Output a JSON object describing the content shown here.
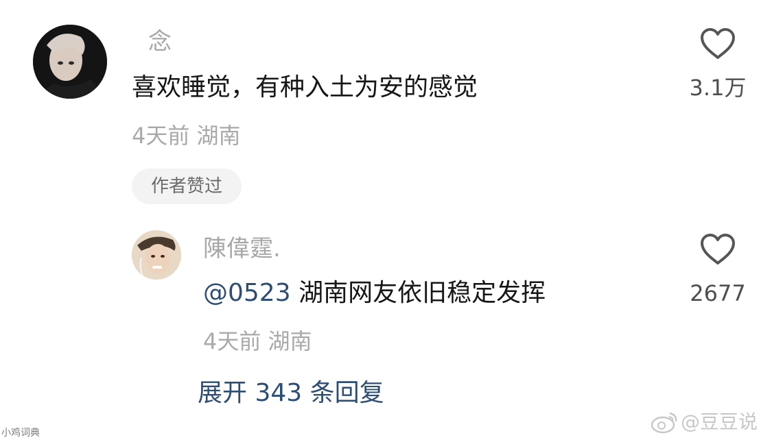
{
  "comment": {
    "username": "念",
    "text": "喜欢睡觉，有种入土为安的感觉",
    "meta": "4天前 湖南",
    "badge": "作者赞过",
    "likes": "3.1万"
  },
  "reply": {
    "username": "陳偉霆.",
    "mention": "@0523",
    "text": " 湖南网友依旧稳定发挥",
    "meta": "4天前 湖南",
    "likes": "2677"
  },
  "expand_replies": "展开 343 条回复",
  "watermarks": {
    "left": "小鸡词典",
    "right": "@豆豆说"
  },
  "icons": {
    "like": "heart-outline-icon",
    "weibo": "weibo-logo-icon"
  },
  "colors": {
    "link": "#2d4d74",
    "muted": "#a9a9a9",
    "text": "#161616"
  }
}
